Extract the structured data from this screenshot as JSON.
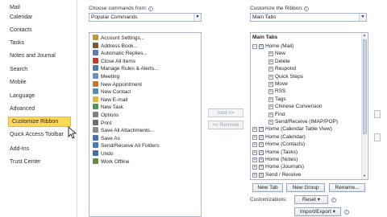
{
  "nav": {
    "items": [
      {
        "label": "Mail"
      },
      {
        "label": "Calendar"
      },
      {
        "label": "Contacts"
      },
      {
        "label": "Tasks"
      },
      {
        "label": "Notes and Journal"
      },
      {
        "label": "Search"
      },
      {
        "label": "Mobile"
      },
      {
        "label": "Language"
      },
      {
        "label": "Advanced"
      },
      {
        "label": "Customize Ribbon"
      },
      {
        "label": "Quick Access Toolbar"
      },
      {
        "label": "Add-Ins"
      },
      {
        "label": "Trust Center"
      }
    ],
    "selected": "Customize Ribbon"
  },
  "left_panel": {
    "label": "Choose commands from:",
    "dropdown_value": "Popular Commands",
    "commands": [
      {
        "label": "Account Settings...",
        "icon": "account-settings-icon",
        "color": "#c8962e"
      },
      {
        "label": "Address Book...",
        "icon": "address-book-icon",
        "color": "#7a5a2e"
      },
      {
        "label": "Automatic Replies...",
        "icon": "automatic-replies-icon",
        "color": "#5a7fb5"
      },
      {
        "label": "Close All Items",
        "icon": "close-items-icon",
        "color": "#c0392b"
      },
      {
        "label": "Manage Rules & Alerts...",
        "icon": "rules-icon",
        "color": "#4a7ab7"
      },
      {
        "label": "Meeting",
        "icon": "meeting-icon",
        "color": "#6a8fc8"
      },
      {
        "label": "New Appointment",
        "icon": "appointment-icon",
        "color": "#d46f2a"
      },
      {
        "label": "New Contact",
        "icon": "contact-icon",
        "color": "#5a8ab0"
      },
      {
        "label": "New E-mail",
        "icon": "email-icon",
        "color": "#e0b73a"
      },
      {
        "label": "New Task",
        "icon": "task-icon",
        "color": "#4f9a4a"
      },
      {
        "label": "Options",
        "icon": "options-icon",
        "color": "#7f7f7f"
      },
      {
        "label": "Print",
        "icon": "print-icon",
        "color": "#6d6d6d"
      },
      {
        "label": "Save All Attachments...",
        "icon": "attachments-icon",
        "color": "#8a8a8a"
      },
      {
        "label": "Save As",
        "icon": "save-as-icon",
        "color": "#4a6fb0"
      },
      {
        "label": "Send/Receive All Folders",
        "icon": "send-receive-icon",
        "color": "#3f7fbf"
      },
      {
        "label": "Undo",
        "icon": "undo-icon",
        "color": "#3e6fb0"
      },
      {
        "label": "Work Offline",
        "icon": "work-offline-icon",
        "color": "#5f8f3f"
      }
    ]
  },
  "middle": {
    "add_label": "Add >>",
    "remove_label": "<< Remove"
  },
  "right_panel": {
    "label": "Customize the Ribbon:",
    "dropdown_value": "Main Tabs",
    "tree_header": "Main Tabs",
    "tree": [
      {
        "label": "Home (Mail)",
        "level": 0,
        "expander": "−",
        "checked": true
      },
      {
        "label": "New",
        "level": 1,
        "expander": "+",
        "checked": null
      },
      {
        "label": "Delete",
        "level": 1,
        "expander": "+",
        "checked": null
      },
      {
        "label": "Respond",
        "level": 1,
        "expander": "+",
        "checked": null
      },
      {
        "label": "Quick Steps",
        "level": 1,
        "expander": "+",
        "checked": null
      },
      {
        "label": "Move",
        "level": 1,
        "expander": "+",
        "checked": null
      },
      {
        "label": "RSS",
        "level": 1,
        "expander": "+",
        "checked": null
      },
      {
        "label": "Tags",
        "level": 1,
        "expander": "+",
        "checked": null
      },
      {
        "label": "Chinese Conversion",
        "level": 1,
        "expander": "+",
        "checked": null
      },
      {
        "label": "Find",
        "level": 1,
        "expander": "+",
        "checked": null
      },
      {
        "label": "Send/Receive (IMAP/POP)",
        "level": 1,
        "expander": "+",
        "checked": null
      },
      {
        "label": "Home (Calendar Table View)",
        "level": 0,
        "expander": "+",
        "checked": true
      },
      {
        "label": "Home (Calendar)",
        "level": 0,
        "expander": "+",
        "checked": true
      },
      {
        "label": "Home (Contacts)",
        "level": 0,
        "expander": "+",
        "checked": true
      },
      {
        "label": "Home (Tasks)",
        "level": 0,
        "expander": "+",
        "checked": true
      },
      {
        "label": "Home (Notes)",
        "level": 0,
        "expander": "+",
        "checked": true
      },
      {
        "label": "Home (Journals)",
        "level": 0,
        "expander": "+",
        "checked": true
      },
      {
        "label": "Send / Receive",
        "level": 0,
        "expander": "+",
        "checked": true
      }
    ],
    "buttons": {
      "new_tab": "New Tab",
      "new_group": "New Group",
      "rename": "Rename..."
    },
    "customizations_label": "Customizations:",
    "reset_label": "Reset ▾",
    "import_export_label": "Import/Export ▾"
  },
  "colors": {
    "selected_nav_bg": "#fdd65a",
    "border": "#a9b4c5",
    "check_color": "#2b4f84"
  }
}
